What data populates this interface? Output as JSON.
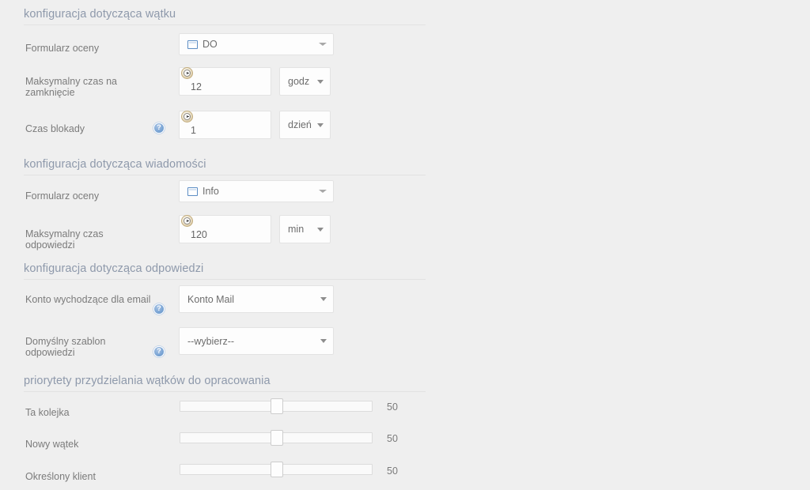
{
  "sections": [
    {
      "id": "thread",
      "title": "konfiguracja dotycząca wątku",
      "rows": [
        {
          "label": "Formularz oceny",
          "control": "form-select",
          "value": "DO",
          "icon": "window-icon"
        },
        {
          "label": "Maksymalny czas na zamknięcie",
          "control": "duration",
          "value": "12",
          "unit": "godz",
          "icon": "clock-icon"
        },
        {
          "label": "Czas blokady",
          "control": "duration",
          "value": "1",
          "unit": "dzień",
          "icon": "clock-icon",
          "help": "help-icon"
        }
      ]
    },
    {
      "id": "message",
      "title": "konfiguracja dotycząca wiadomości",
      "rows": [
        {
          "label": "Formularz oceny",
          "control": "form-select",
          "value": "Info",
          "icon": "window-icon"
        },
        {
          "label": "Maksymalny czas odpowiedzi",
          "control": "duration",
          "value": "120",
          "unit": "min",
          "icon": "clock-icon"
        }
      ]
    },
    {
      "id": "reply",
      "title": "konfiguracja dotycząca odpowiedzi",
      "rows": [
        {
          "label": "Konto wychodzące dla email",
          "control": "select",
          "value": "Konto Mail",
          "help": "help-icon"
        },
        {
          "label": "Domyślny szablon odpowiedzi",
          "control": "select",
          "value": "--wybierz--",
          "help": "help-icon"
        }
      ]
    },
    {
      "id": "priorities",
      "title": "priorytety przydzielania wątków do opracowania",
      "rows": [
        {
          "label": "Ta kolejka",
          "control": "slider",
          "value": "50"
        },
        {
          "label": "Nowy wątek",
          "control": "slider",
          "value": "50"
        },
        {
          "label": "Określony klient",
          "control": "slider",
          "value": "50"
        }
      ]
    }
  ],
  "slider_range": {
    "min": "0",
    "max": "100"
  },
  "colors": {
    "background": "#efefef",
    "header_text": "#8e99ab",
    "label_text": "#7b7b7b",
    "field_border": "#e3e3e3",
    "field_background": "#fdfdfd",
    "rule": "#e2e2e2",
    "help_icon": "#6d9bd1"
  }
}
